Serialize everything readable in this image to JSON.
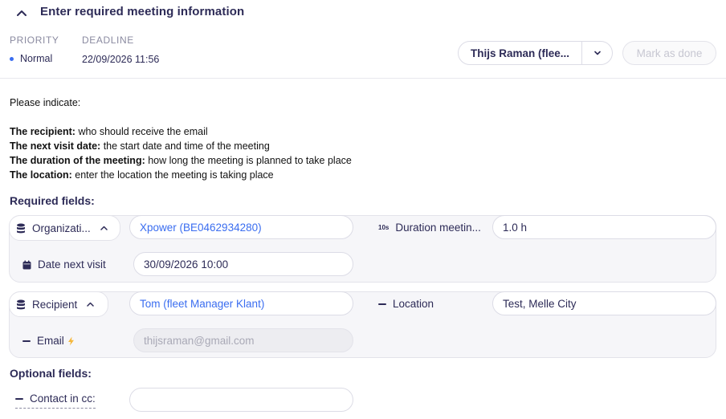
{
  "header": {
    "title": "Enter required meeting information",
    "priority_label": "PRIORITY",
    "priority_value": "Normal",
    "deadline_label": "DEADLINE",
    "deadline_value": "22/09/2026 11:56",
    "assignee": "Thijs Raman (flee...",
    "mark_done": "Mark as done"
  },
  "instructions": {
    "intro": "Please indicate:",
    "items": [
      {
        "bold": "The recipient:",
        "text": " who should receive the email"
      },
      {
        "bold": "The next visit date:",
        "text": " the start date and time of the meeting"
      },
      {
        "bold": "The duration of the meeting:",
        "text": " how long the meeting is planned to take place"
      },
      {
        "bold": "The location:",
        "text": " enter the location the meeting is taking place"
      }
    ]
  },
  "required": {
    "title": "Required fields:",
    "organization_label": "Organizati...",
    "organization_value": "Xpower (BE0462934280)",
    "duration_tag": "10s",
    "duration_label": "Duration meetin...",
    "duration_value": "1.0 h",
    "date_label": "Date next visit",
    "date_value": "30/09/2026 10:00",
    "recipient_label": "Recipient",
    "recipient_value": "Tom (fleet Manager Klant)",
    "location_label": "Location",
    "location_value": "Test, Melle City",
    "email_label": "Email",
    "email_value": "thijsraman@gmail.com"
  },
  "optional": {
    "title": "Optional fields:",
    "cc_label": "Contact in cc:",
    "cc_value": ""
  },
  "colors": {
    "accent": "#3a6df0",
    "text": "#2d2b57",
    "lightning": "#f5b73b"
  }
}
